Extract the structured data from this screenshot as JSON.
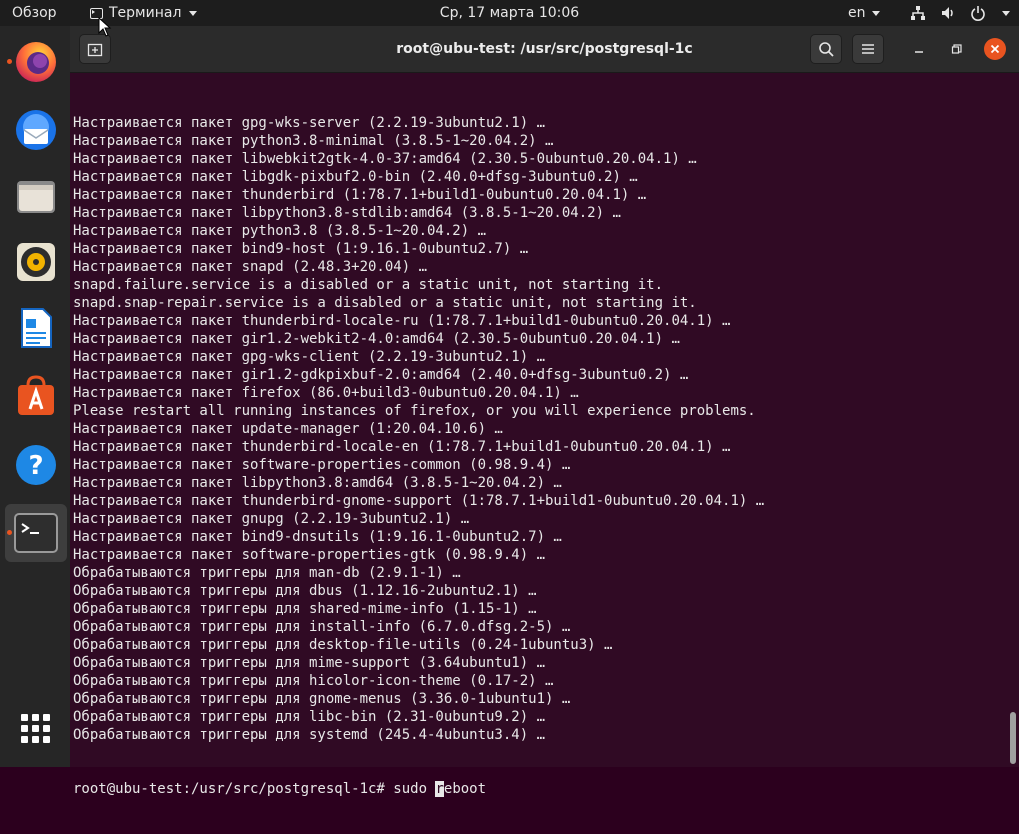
{
  "topbar": {
    "activities": "Обзор",
    "app_menu": "Терминал",
    "clock": "Ср, 17 марта  10:06",
    "lang": "en"
  },
  "icons": {
    "network": "network-icon",
    "volume": "volume-icon",
    "power": "power-icon",
    "system_menu": "chevron-down-icon"
  },
  "dock": {
    "items": [
      {
        "name": "firefox",
        "running": true
      },
      {
        "name": "thunderbird",
        "running": false
      },
      {
        "name": "files",
        "running": false
      },
      {
        "name": "rhythmbox",
        "running": false
      },
      {
        "name": "libreoffice-writer",
        "running": false
      },
      {
        "name": "ubuntu-software",
        "running": false
      },
      {
        "name": "help",
        "running": false
      },
      {
        "name": "terminal",
        "running": true
      }
    ]
  },
  "window": {
    "title": "root@ubu-test: /usr/src/postgresql-1c"
  },
  "terminal": {
    "lines": [
      "Настраивается пакет gpg-wks-server (2.2.19-3ubuntu2.1) …",
      "Настраивается пакет python3.8-minimal (3.8.5-1~20.04.2) …",
      "Настраивается пакет libwebkit2gtk-4.0-37:amd64 (2.30.5-0ubuntu0.20.04.1) …",
      "Настраивается пакет libgdk-pixbuf2.0-bin (2.40.0+dfsg-3ubuntu0.2) …",
      "Настраивается пакет thunderbird (1:78.7.1+build1-0ubuntu0.20.04.1) …",
      "Настраивается пакет libpython3.8-stdlib:amd64 (3.8.5-1~20.04.2) …",
      "Настраивается пакет python3.8 (3.8.5-1~20.04.2) …",
      "Настраивается пакет bind9-host (1:9.16.1-0ubuntu2.7) …",
      "Настраивается пакет snapd (2.48.3+20.04) …",
      "snapd.failure.service is a disabled or a static unit, not starting it.",
      "snapd.snap-repair.service is a disabled or a static unit, not starting it.",
      "Настраивается пакет thunderbird-locale-ru (1:78.7.1+build1-0ubuntu0.20.04.1) …",
      "Настраивается пакет gir1.2-webkit2-4.0:amd64 (2.30.5-0ubuntu0.20.04.1) …",
      "Настраивается пакет gpg-wks-client (2.2.19-3ubuntu2.1) …",
      "Настраивается пакет gir1.2-gdkpixbuf-2.0:amd64 (2.40.0+dfsg-3ubuntu0.2) …",
      "Настраивается пакет firefox (86.0+build3-0ubuntu0.20.04.1) …",
      "Please restart all running instances of firefox, or you will experience problems.",
      "Настраивается пакет update-manager (1:20.04.10.6) …",
      "Настраивается пакет thunderbird-locale-en (1:78.7.1+build1-0ubuntu0.20.04.1) …",
      "Настраивается пакет software-properties-common (0.98.9.4) …",
      "Настраивается пакет libpython3.8:amd64 (3.8.5-1~20.04.2) …",
      "Настраивается пакет thunderbird-gnome-support (1:78.7.1+build1-0ubuntu0.20.04.1) …",
      "Настраивается пакет gnupg (2.2.19-3ubuntu2.1) …",
      "Настраивается пакет bind9-dnsutils (1:9.16.1-0ubuntu2.7) …",
      "Настраивается пакет software-properties-gtk (0.98.9.4) …",
      "Обрабатываются триггеры для man-db (2.9.1-1) …",
      "Обрабатываются триггеры для dbus (1.12.16-2ubuntu2.1) …",
      "Обрабатываются триггеры для shared-mime-info (1.15-1) …",
      "Обрабатываются триггеры для install-info (6.7.0.dfsg.2-5) …",
      "Обрабатываются триггеры для desktop-file-utils (0.24-1ubuntu3) …",
      "Обрабатываются триггеры для mime-support (3.64ubuntu1) …",
      "Обрабатываются триггеры для hicolor-icon-theme (0.17-2) …",
      "Обрабатываются триггеры для gnome-menus (3.36.0-1ubuntu1) …",
      "Обрабатываются триггеры для libc-bin (2.31-0ubuntu9.2) …",
      "Обрабатываются триггеры для systemd (245.4-4ubuntu3.4) …"
    ],
    "prompt": "root@ubu-test:/usr/src/postgresql-1c# ",
    "command_before_cursor": "sudo ",
    "cursor_char": "r",
    "command_after_cursor": "eboot"
  },
  "colors": {
    "terminal_bg": "#300a24",
    "accent": "#e95420"
  }
}
